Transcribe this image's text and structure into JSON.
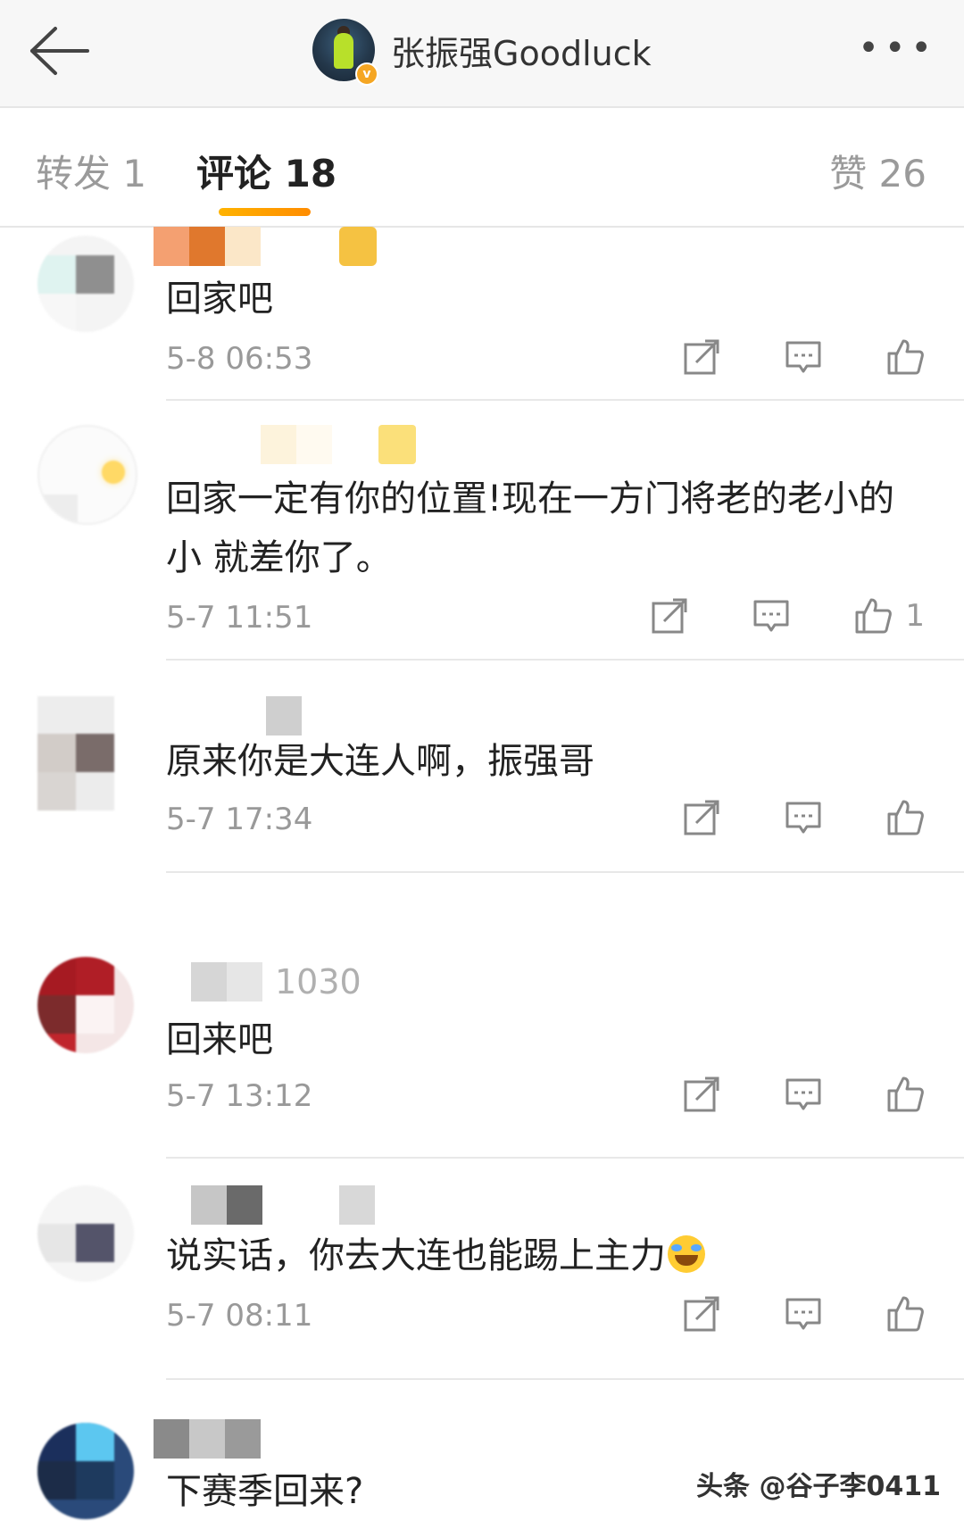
{
  "header": {
    "back_icon": "back-arrow-icon",
    "account_name": "张振强Goodluck",
    "verified_badge": "v",
    "more_label": "•••"
  },
  "tabs": {
    "repost": "转发 1",
    "comments": "评论 18",
    "likes": "赞 26",
    "active": "comments",
    "accent_color": "#ff9900"
  },
  "comments": [
    {
      "text": "回家吧",
      "time": "5-8 06:53",
      "likes": ""
    },
    {
      "text": "回家一定有你的位置!现在一方门将老的老小的小 就差你了。",
      "time": "5-7 11:51",
      "likes": "1"
    },
    {
      "text": "原来你是大连人啊，振强哥",
      "time": "5-7 17:34",
      "likes": ""
    },
    {
      "name_fragment": "1030",
      "text": "回来吧",
      "time": "5-7 13:12",
      "likes": ""
    },
    {
      "text": "说实话，你去大连也能踢上主力",
      "time": "5-7 08:11",
      "likes": ""
    },
    {
      "text": "下赛季回来?",
      "time": "",
      "likes": ""
    }
  ],
  "watermark": "头条 @谷子李0411"
}
